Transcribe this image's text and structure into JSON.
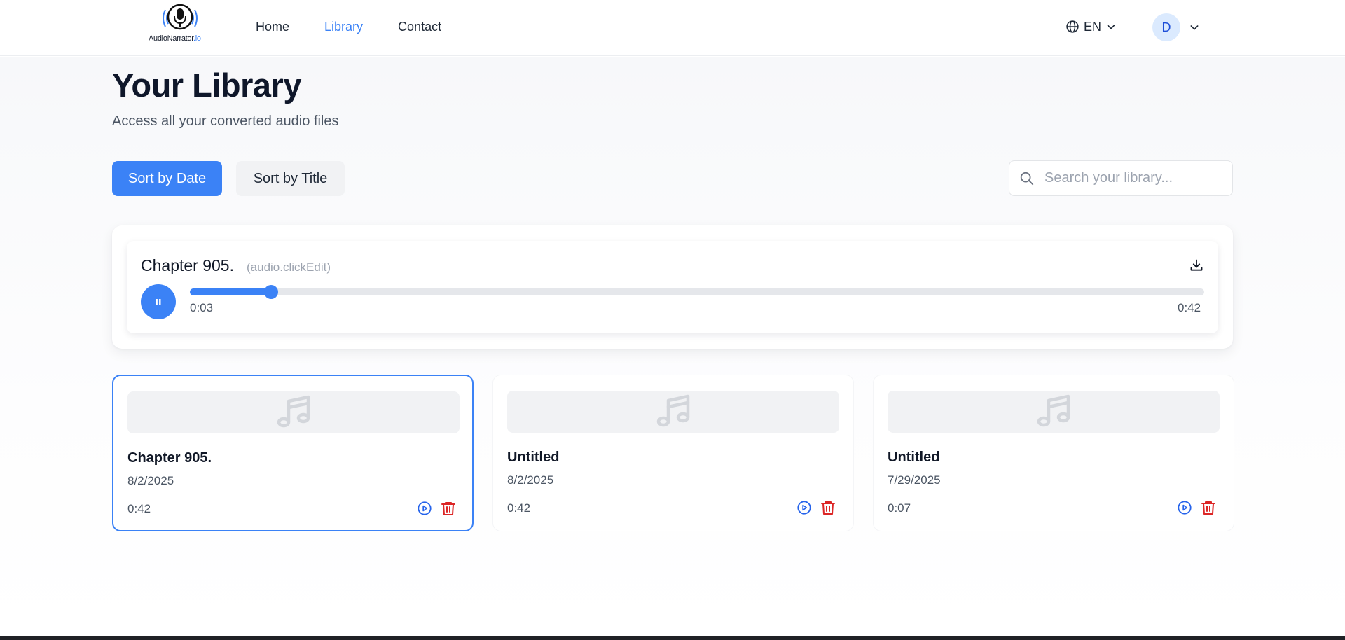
{
  "header": {
    "logo": {
      "name": "AudioNarrator",
      "tld": ".io"
    },
    "nav": [
      {
        "label": "Home",
        "active": false
      },
      {
        "label": "Library",
        "active": true
      },
      {
        "label": "Contact",
        "active": false
      }
    ],
    "language": {
      "code": "EN",
      "icon": "globe-icon"
    },
    "user": {
      "initial": "D"
    }
  },
  "page": {
    "title": "Your Library",
    "subtitle": "Access all your converted audio files"
  },
  "toolbar": {
    "sort_date_label": "Sort by Date",
    "sort_title_label": "Sort by Title",
    "active_sort": "date",
    "search_placeholder": "Search your library...",
    "search_value": ""
  },
  "player": {
    "title": "Chapter 905.",
    "hint": "(audio.clickEdit)",
    "current_time": "0:03",
    "total_time": "0:42",
    "progress": 0.08,
    "state": "playing"
  },
  "cards": [
    {
      "title": "Chapter 905.",
      "date": "8/2/2025",
      "duration": "0:42",
      "selected": true
    },
    {
      "title": "Untitled",
      "date": "8/2/2025",
      "duration": "0:42",
      "selected": false
    },
    {
      "title": "Untitled",
      "date": "7/29/2025",
      "duration": "0:07",
      "selected": false
    }
  ],
  "colors": {
    "accent": "#3b82f6",
    "delete": "#dc2626",
    "text_primary": "#111827",
    "text_secondary": "#4b5563",
    "placeholder": "#9ca3af"
  }
}
